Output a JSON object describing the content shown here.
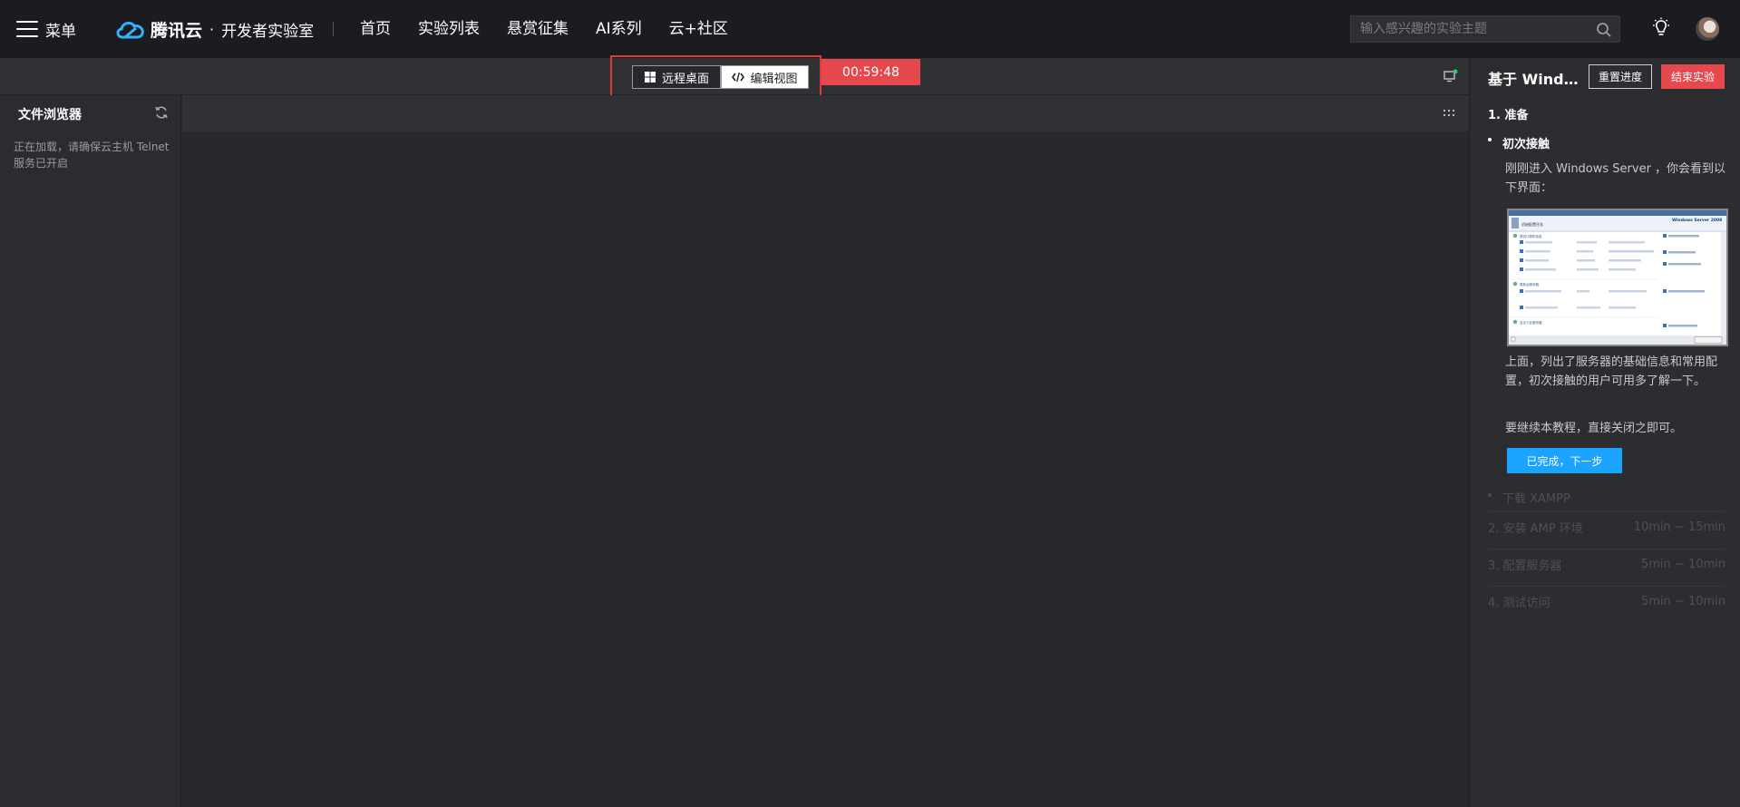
{
  "nav": {
    "menu_label": "菜单",
    "brand_name": "腾讯云",
    "brand_dot": "·",
    "brand_sub": "开发者实验室",
    "links": [
      "首页",
      "实验列表",
      "悬赏征集",
      "AI系列",
      "云+社区"
    ],
    "search_placeholder": "输入感兴趣的实验主题"
  },
  "toolbar": {
    "remote_label": "远程桌面",
    "edit_label": "编辑视图",
    "timer": "00:59:48"
  },
  "file_browser": {
    "title": "文件浏览器",
    "message": "正在加载，请确保云主机 Telnet 服务已开启"
  },
  "panel": {
    "title": "基于 Windows Server 搭建 AMP 环境",
    "reset_label": "重置进度",
    "end_label": "结束实验",
    "section_title": "1. 准备",
    "step_title": "初次接触",
    "text1": "刚刚进入 Windows Server ，你会看到以下界面：",
    "text2": "上面，列出了服务器的基础信息和常用配置，初次接触的用户可用多了解一下。",
    "text3": "要继续本教程，直接关闭之即可。",
    "next_label": "已完成，下一步",
    "sub_step": "下载 XAMPP",
    "rows": [
      {
        "label": "2. 安装 AMP 环境",
        "time": "10min ~ 15min"
      },
      {
        "label": "3. 配置服务器",
        "time": "5min ~ 10min"
      },
      {
        "label": "4. 测试访问",
        "time": "5min ~ 10min"
      }
    ],
    "shot": {
      "header": "初始配置任务",
      "brand": "Windows Server 2008",
      "sections": [
        "提供计算机信息",
        "更新此服务器",
        "自定义此服务器"
      ]
    }
  },
  "colors": {
    "accent_red": "#e5484d",
    "accent_blue": "#1aa3ff",
    "nav_bg": "#1b1c20"
  }
}
